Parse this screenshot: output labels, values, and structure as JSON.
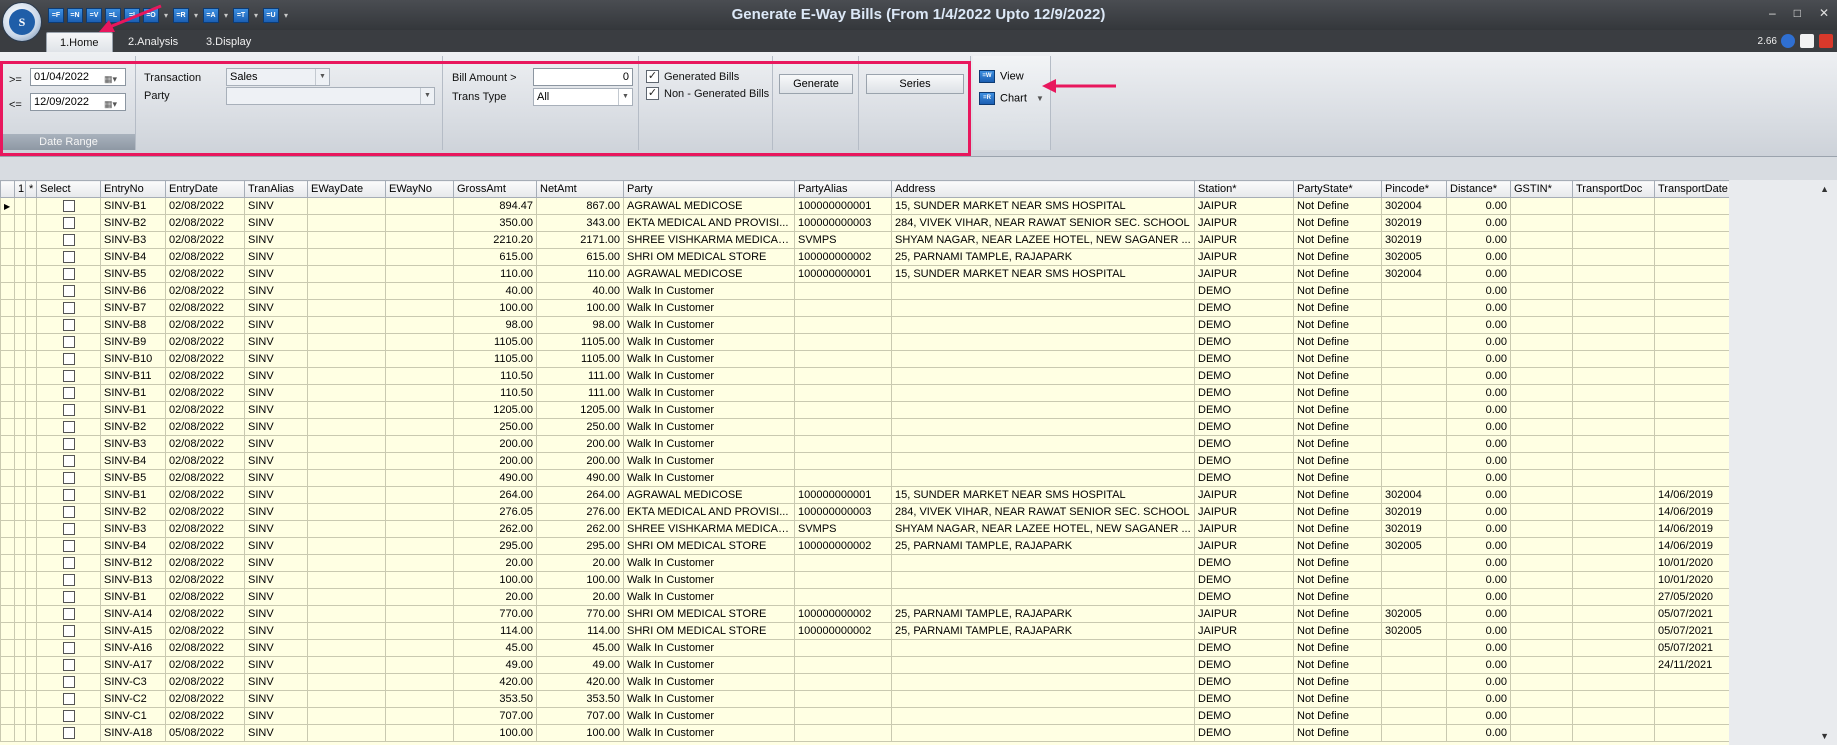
{
  "window": {
    "title": "Generate E-Way Bills (From 1/4/2022 Upto 12/9/2022)",
    "version": "2.66"
  },
  "qat_buttons": [
    "=F",
    "=N",
    "=V",
    "=L",
    "=I",
    "=O",
    "=R",
    "=A",
    "=T",
    "=U"
  ],
  "tabs": [
    "1.Home",
    "2.Analysis",
    "3.Display"
  ],
  "date_range": {
    "from_label": ">=",
    "from_value": "01/04/2022",
    "to_label": "<=",
    "to_value": "12/09/2022",
    "caption": "Date Range"
  },
  "transaction": {
    "label": "Transaction",
    "value": "Sales",
    "party_label": "Party",
    "party_value": ""
  },
  "bill": {
    "amount_label": "Bill Amount >",
    "amount_value": "0",
    "trans_type_label": "Trans Type",
    "trans_type_value": "All"
  },
  "filters": {
    "generated_label": "Generated Bills",
    "generated_checked": true,
    "non_generated_label": "Non - Generated Bills",
    "non_generated_checked": true
  },
  "buttons": {
    "generate": "Generate",
    "series": "Series",
    "view": "View",
    "chart": "Chart"
  },
  "grid": {
    "columns": [
      "",
      "1",
      "*",
      "Select",
      "EntryNo",
      "EntryDate",
      "TranAlias",
      "EWayDate",
      "EWayNo",
      "GrossAmt",
      "NetAmt",
      "Party",
      "PartyAlias",
      "Address",
      "Station*",
      "PartyState*",
      "Pincode*",
      "Distance*",
      "GSTIN*",
      "TransportDoc",
      "TransportDate"
    ],
    "rows": [
      [
        "SINV-B1",
        "02/08/2022",
        "SINV",
        "",
        "",
        "894.47",
        "867.00",
        "AGRAWAL MEDICOSE",
        "100000000001",
        "15, SUNDER MARKET NEAR SMS HOSPITAL",
        "JAIPUR",
        "Not Define",
        "302004",
        "0.00",
        "",
        "",
        ""
      ],
      [
        "SINV-B2",
        "02/08/2022",
        "SINV",
        "",
        "",
        "350.00",
        "343.00",
        "EKTA MEDICAL AND PROVISI...",
        "100000000003",
        "284, VIVEK VIHAR, NEAR RAWAT SENIOR  SEC. SCHOOL",
        "JAIPUR",
        "Not Define",
        "302019",
        "0.00",
        "",
        "",
        ""
      ],
      [
        "SINV-B3",
        "02/08/2022",
        "SINV",
        "",
        "",
        "2210.20",
        "2171.00",
        "SHREE VISHKARMA MEDICAL...",
        "SVMPS",
        "SHYAM NAGAR, NEAR LAZEE HOTEL, NEW SAGANER ...",
        "JAIPUR",
        "Not Define",
        "302019",
        "0.00",
        "",
        "",
        ""
      ],
      [
        "SINV-B4",
        "02/08/2022",
        "SINV",
        "",
        "",
        "615.00",
        "615.00",
        "SHRI OM MEDICAL STORE",
        "100000000002",
        "25, PARNAMI TAMPLE, RAJAPARK",
        "JAIPUR",
        "Not Define",
        "302005",
        "0.00",
        "",
        "",
        ""
      ],
      [
        "SINV-B5",
        "02/08/2022",
        "SINV",
        "",
        "",
        "110.00",
        "110.00",
        "AGRAWAL MEDICOSE",
        "100000000001",
        "15, SUNDER MARKET NEAR SMS HOSPITAL",
        "JAIPUR",
        "Not Define",
        "302004",
        "0.00",
        "",
        "",
        ""
      ],
      [
        "SINV-B6",
        "02/08/2022",
        "SINV",
        "",
        "",
        "40.00",
        "40.00",
        "Walk In Customer",
        "",
        "",
        "DEMO",
        "Not Define",
        "",
        "0.00",
        "",
        "",
        ""
      ],
      [
        "SINV-B7",
        "02/08/2022",
        "SINV",
        "",
        "",
        "100.00",
        "100.00",
        "Walk In Customer",
        "",
        "",
        "DEMO",
        "Not Define",
        "",
        "0.00",
        "",
        "",
        ""
      ],
      [
        "SINV-B8",
        "02/08/2022",
        "SINV",
        "",
        "",
        "98.00",
        "98.00",
        "Walk In Customer",
        "",
        "",
        "DEMO",
        "Not Define",
        "",
        "0.00",
        "",
        "",
        ""
      ],
      [
        "SINV-B9",
        "02/08/2022",
        "SINV",
        "",
        "",
        "1105.00",
        "1105.00",
        "Walk In Customer",
        "",
        "",
        "DEMO",
        "Not Define",
        "",
        "0.00",
        "",
        "",
        ""
      ],
      [
        "SINV-B10",
        "02/08/2022",
        "SINV",
        "",
        "",
        "1105.00",
        "1105.00",
        "Walk In Customer",
        "",
        "",
        "DEMO",
        "Not Define",
        "",
        "0.00",
        "",
        "",
        ""
      ],
      [
        "SINV-B11",
        "02/08/2022",
        "SINV",
        "",
        "",
        "110.50",
        "111.00",
        "Walk In Customer",
        "",
        "",
        "DEMO",
        "Not Define",
        "",
        "0.00",
        "",
        "",
        ""
      ],
      [
        "SINV-B1",
        "02/08/2022",
        "SINV",
        "",
        "",
        "110.50",
        "111.00",
        "Walk In Customer",
        "",
        "",
        "DEMO",
        "Not Define",
        "",
        "0.00",
        "",
        "",
        ""
      ],
      [
        "SINV-B1",
        "02/08/2022",
        "SINV",
        "",
        "",
        "1205.00",
        "1205.00",
        "Walk In Customer",
        "",
        "",
        "DEMO",
        "Not Define",
        "",
        "0.00",
        "",
        "",
        ""
      ],
      [
        "SINV-B2",
        "02/08/2022",
        "SINV",
        "",
        "",
        "250.00",
        "250.00",
        "Walk In Customer",
        "",
        "",
        "DEMO",
        "Not Define",
        "",
        "0.00",
        "",
        "",
        ""
      ],
      [
        "SINV-B3",
        "02/08/2022",
        "SINV",
        "",
        "",
        "200.00",
        "200.00",
        "Walk In Customer",
        "",
        "",
        "DEMO",
        "Not Define",
        "",
        "0.00",
        "",
        "",
        ""
      ],
      [
        "SINV-B4",
        "02/08/2022",
        "SINV",
        "",
        "",
        "200.00",
        "200.00",
        "Walk In Customer",
        "",
        "",
        "DEMO",
        "Not Define",
        "",
        "0.00",
        "",
        "",
        ""
      ],
      [
        "SINV-B5",
        "02/08/2022",
        "SINV",
        "",
        "",
        "490.00",
        "490.00",
        "Walk In Customer",
        "",
        "",
        "DEMO",
        "Not Define",
        "",
        "0.00",
        "",
        "",
        ""
      ],
      [
        "SINV-B1",
        "02/08/2022",
        "SINV",
        "",
        "",
        "264.00",
        "264.00",
        "AGRAWAL MEDICOSE",
        "100000000001",
        "15, SUNDER MARKET NEAR SMS HOSPITAL",
        "JAIPUR",
        "Not Define",
        "302004",
        "0.00",
        "",
        "",
        "14/06/2019"
      ],
      [
        "SINV-B2",
        "02/08/2022",
        "SINV",
        "",
        "",
        "276.05",
        "276.00",
        "EKTA MEDICAL AND PROVISI...",
        "100000000003",
        "284, VIVEK VIHAR, NEAR RAWAT SENIOR  SEC. SCHOOL",
        "JAIPUR",
        "Not Define",
        "302019",
        "0.00",
        "",
        "",
        "14/06/2019"
      ],
      [
        "SINV-B3",
        "02/08/2022",
        "SINV",
        "",
        "",
        "262.00",
        "262.00",
        "SHREE VISHKARMA MEDICAL...",
        "SVMPS",
        "SHYAM NAGAR, NEAR LAZEE HOTEL, NEW SAGANER ...",
        "JAIPUR",
        "Not Define",
        "302019",
        "0.00",
        "",
        "",
        "14/06/2019"
      ],
      [
        "SINV-B4",
        "02/08/2022",
        "SINV",
        "",
        "",
        "295.00",
        "295.00",
        "SHRI OM MEDICAL STORE",
        "100000000002",
        "25, PARNAMI TAMPLE, RAJAPARK",
        "JAIPUR",
        "Not Define",
        "302005",
        "0.00",
        "",
        "",
        "14/06/2019"
      ],
      [
        "SINV-B12",
        "02/08/2022",
        "SINV",
        "",
        "",
        "20.00",
        "20.00",
        "Walk In Customer",
        "",
        "",
        "DEMO",
        "Not Define",
        "",
        "0.00",
        "",
        "",
        "10/01/2020"
      ],
      [
        "SINV-B13",
        "02/08/2022",
        "SINV",
        "",
        "",
        "100.00",
        "100.00",
        "Walk In Customer",
        "",
        "",
        "DEMO",
        "Not Define",
        "",
        "0.00",
        "",
        "",
        "10/01/2020"
      ],
      [
        "SINV-B1",
        "02/08/2022",
        "SINV",
        "",
        "",
        "20.00",
        "20.00",
        "Walk In Customer",
        "",
        "",
        "DEMO",
        "Not Define",
        "",
        "0.00",
        "",
        "",
        "27/05/2020"
      ],
      [
        "SINV-A14",
        "02/08/2022",
        "SINV",
        "",
        "",
        "770.00",
        "770.00",
        "SHRI OM MEDICAL STORE",
        "100000000002",
        "25, PARNAMI TAMPLE, RAJAPARK",
        "JAIPUR",
        "Not Define",
        "302005",
        "0.00",
        "",
        "",
        "05/07/2021"
      ],
      [
        "SINV-A15",
        "02/08/2022",
        "SINV",
        "",
        "",
        "114.00",
        "114.00",
        "SHRI OM MEDICAL STORE",
        "100000000002",
        "25, PARNAMI TAMPLE, RAJAPARK",
        "JAIPUR",
        "Not Define",
        "302005",
        "0.00",
        "",
        "",
        "05/07/2021"
      ],
      [
        "SINV-A16",
        "02/08/2022",
        "SINV",
        "",
        "",
        "45.00",
        "45.00",
        "Walk In Customer",
        "",
        "",
        "DEMO",
        "Not Define",
        "",
        "0.00",
        "",
        "",
        "05/07/2021"
      ],
      [
        "SINV-A17",
        "02/08/2022",
        "SINV",
        "",
        "",
        "49.00",
        "49.00",
        "Walk In Customer",
        "",
        "",
        "DEMO",
        "Not Define",
        "",
        "0.00",
        "",
        "",
        "24/11/2021"
      ],
      [
        "SINV-C3",
        "02/08/2022",
        "SINV",
        "",
        "",
        "420.00",
        "420.00",
        "Walk In Customer",
        "",
        "",
        "DEMO",
        "Not Define",
        "",
        "0.00",
        "",
        "",
        ""
      ],
      [
        "SINV-C2",
        "02/08/2022",
        "SINV",
        "",
        "",
        "353.50",
        "353.50",
        "Walk In Customer",
        "",
        "",
        "DEMO",
        "Not Define",
        "",
        "0.00",
        "",
        "",
        ""
      ],
      [
        "SINV-C1",
        "02/08/2022",
        "SINV",
        "",
        "",
        "707.00",
        "707.00",
        "Walk In Customer",
        "",
        "",
        "DEMO",
        "Not Define",
        "",
        "0.00",
        "",
        "",
        ""
      ],
      [
        "SINV-A18",
        "05/08/2022",
        "SINV",
        "",
        "",
        "100.00",
        "100.00",
        "Walk In Customer",
        "",
        "",
        "DEMO",
        "Not Define",
        "",
        "0.00",
        "",
        "",
        ""
      ]
    ]
  },
  "colors": {
    "highlight": "#e8175d",
    "grid_bg": "#ffffe3",
    "title": "#dce8f7"
  }
}
